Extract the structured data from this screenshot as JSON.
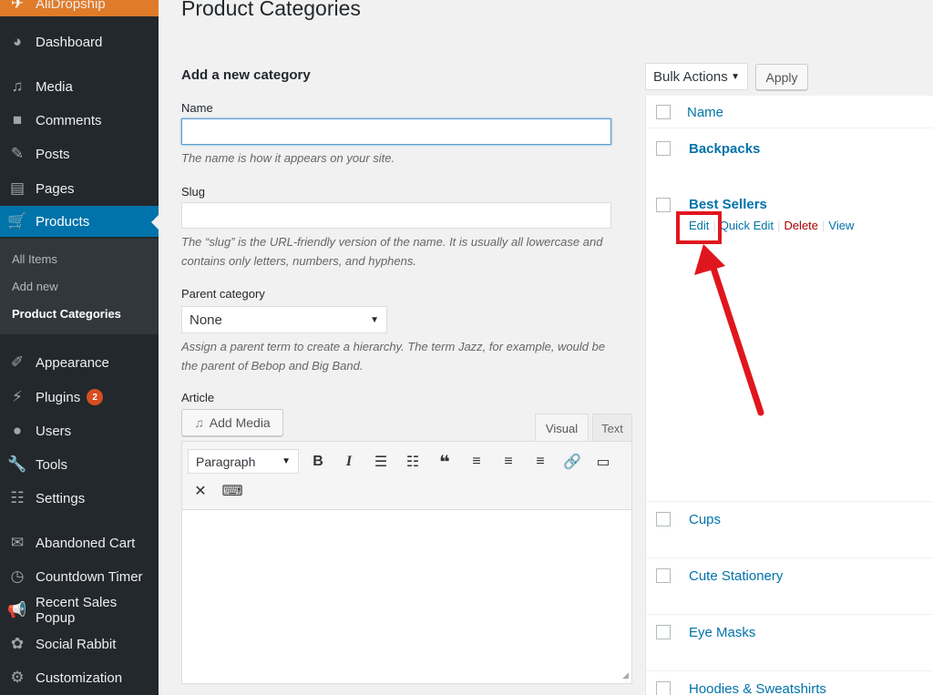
{
  "sidebar": {
    "top_item": "AliDropship",
    "items": [
      {
        "label": "Dashboard",
        "icon": "dashboard-icon"
      },
      {
        "label": "Media",
        "icon": "media-icon"
      },
      {
        "label": "Comments",
        "icon": "comments-icon"
      },
      {
        "label": "Posts",
        "icon": "pin-icon"
      },
      {
        "label": "Pages",
        "icon": "pages-icon"
      },
      {
        "label": "Products",
        "icon": "cart-icon"
      },
      {
        "label": "Appearance",
        "icon": "brush-icon"
      },
      {
        "label": "Plugins",
        "icon": "plugin-icon",
        "badge": "2"
      },
      {
        "label": "Users",
        "icon": "user-icon"
      },
      {
        "label": "Tools",
        "icon": "wrench-icon"
      },
      {
        "label": "Settings",
        "icon": "settings-icon"
      },
      {
        "label": "Abandoned Cart",
        "icon": "mail-icon"
      },
      {
        "label": "Countdown Timer",
        "icon": "clock-icon"
      },
      {
        "label": "Recent Sales Popup",
        "icon": "megaphone-icon"
      },
      {
        "label": "Social Rabbit",
        "icon": "rabbit-icon"
      },
      {
        "label": "Customization",
        "icon": "gear-icon"
      }
    ],
    "submenu": [
      "All Items",
      "Add new",
      "Product Categories"
    ]
  },
  "page": {
    "title": "Product Categories",
    "form_title": "Add a new category",
    "name_label": "Name",
    "name_value": "",
    "name_help": "The name is how it appears on your site.",
    "slug_label": "Slug",
    "slug_value": "",
    "slug_help_1": "The “slug” is the URL-friendly version of the name. It is usually all lowercase and",
    "slug_help_2": "contains only letters, numbers, and hyphens.",
    "parent_label": "Parent category",
    "parent_value": "None",
    "parent_help_1": "Assign a parent term to create a hierarchy. The term Jazz, for example, would be",
    "parent_help_2": "the parent of Bebop and Big Band.",
    "article_label": "Article",
    "add_media": "Add Media",
    "tab_visual": "Visual",
    "tab_text": "Text",
    "format_value": "Paragraph"
  },
  "list": {
    "bulk_actions": "Bulk Actions",
    "apply": "Apply",
    "column_name": "Name",
    "rows": [
      "Backpacks",
      "Best Sellers",
      "Cups",
      "Cute Stationery",
      "Eye Masks",
      "Hoodies & Sweatshirts"
    ],
    "row_actions": {
      "edit": "Edit",
      "quick_edit": "Quick Edit",
      "delete": "Delete",
      "view": "View"
    }
  },
  "colors": {
    "accent": "#0073aa",
    "highlight": "#e0161e",
    "brand": "#e07b2a"
  }
}
